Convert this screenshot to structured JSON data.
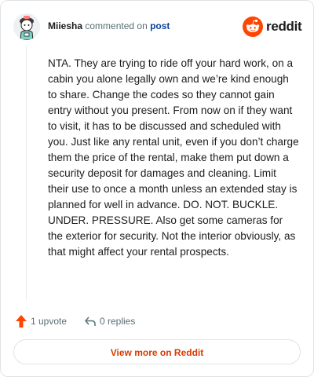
{
  "comment": {
    "author": "Miiesha",
    "action_text": "commented on",
    "target_link": "post",
    "body": "NTA. They are trying to ride off your hard work, on a cabin you alone legally own and we’re kind enough to share. Change the codes so they cannot gain entry without you present. From now on if they want to visit, it has to be discussed and scheduled with you. Just like any rental unit, even if you don’t charge them the price of the rental, make them put down a security deposit for damages and cleaning. Limit their use to once a month unless an extended stay is planned for well in advance. DO. NOT. BUCKLE. UNDER. PRESSURE. Also get some cameras for the exterior for security. Not the interior obviously, as that might affect your rental prospects."
  },
  "brand": {
    "wordmark": "reddit",
    "icon": "reddit-logo-icon",
    "color": "#ff4500"
  },
  "actions": {
    "upvote_label": "1 upvote",
    "upvote_icon": "upvote-arrow-icon",
    "replies_label": "0 replies",
    "replies_icon": "reply-arrow-icon"
  },
  "footer": {
    "view_more_label": "View more on Reddit"
  },
  "colors": {
    "accent": "#d93a00",
    "link": "#0a449b",
    "muted": "#576f76"
  }
}
